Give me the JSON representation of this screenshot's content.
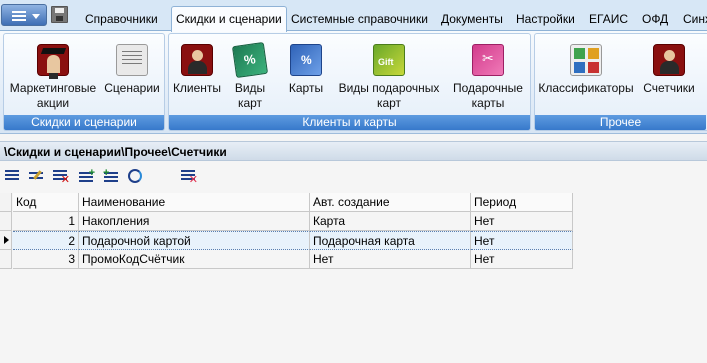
{
  "tabs": [
    {
      "label": "Справочники"
    },
    {
      "label": "Скидки и сценарии",
      "active": true
    },
    {
      "label": "Системные справочники"
    },
    {
      "label": "Документы"
    },
    {
      "label": "Настройки"
    },
    {
      "label": "ЕГАИС"
    },
    {
      "label": "ОФД"
    },
    {
      "label": "Синх"
    }
  ],
  "ribbon": {
    "groups": [
      {
        "label": "Скидки и сценарии",
        "buttons": [
          {
            "line1": "Маркетинговые",
            "line2": "акции",
            "icon": "marketing-promo-icon"
          },
          {
            "line1": "Сценарии",
            "line2": "",
            "icon": "scenarios-document-icon"
          }
        ]
      },
      {
        "label": "Клиенты и карты",
        "buttons": [
          {
            "line1": "Клиенты",
            "line2": "",
            "icon": "clients-person-icon"
          },
          {
            "line1": "Виды",
            "line2": "карт",
            "icon": "card-types-icon"
          },
          {
            "line1": "Карты",
            "line2": "",
            "icon": "cards-icon"
          },
          {
            "line1": "Виды подарочных",
            "line2": "карт",
            "icon": "gift-card-types-icon"
          },
          {
            "line1": "Подарочные",
            "line2": "карты",
            "icon": "gift-cards-icon"
          }
        ]
      },
      {
        "label": "Прочее",
        "buttons": [
          {
            "line1": "Классификаторы",
            "line2": "",
            "icon": "classifiers-icon"
          },
          {
            "line1": "Счетчики",
            "line2": "",
            "icon": "counters-person-icon"
          }
        ]
      }
    ]
  },
  "breadcrumb": "\\Скидки и сценарии\\Прочее\\Счетчики",
  "toolbar": {
    "icons": [
      "list-view-icon",
      "edit-record-icon",
      "delete-record-icon",
      "add-record-icon",
      "add-child-record-icon",
      "refresh-icon",
      "clear-filter-icon"
    ]
  },
  "grid": {
    "columns": [
      "Код",
      "Наименование",
      "Авт. создание",
      "Период"
    ],
    "rows": [
      {
        "code": "1",
        "name": "Накопления",
        "auto": "Карта",
        "period": "Нет",
        "selected": false
      },
      {
        "code": "2",
        "name": "Подарочной картой",
        "auto": "Подарочная карта",
        "period": "Нет",
        "selected": true
      },
      {
        "code": "3",
        "name": "ПромоКодСчётчик",
        "auto": "Нет",
        "period": "Нет",
        "selected": false
      }
    ]
  },
  "colors": {
    "ribbon_group_label_bg": "#3779cb",
    "selected_row_bg": "#e8f2fb"
  }
}
